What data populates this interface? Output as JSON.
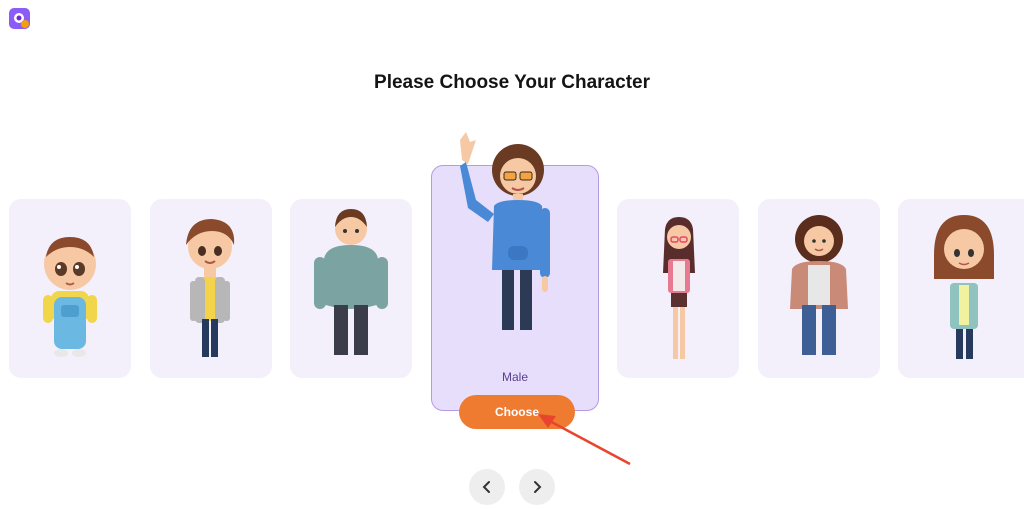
{
  "page": {
    "title": "Please Choose Your Character"
  },
  "characters": [
    {
      "id": "baby"
    },
    {
      "id": "boy"
    },
    {
      "id": "chubby-man"
    },
    {
      "id": "male",
      "label": "Male",
      "selected": true
    },
    {
      "id": "girl"
    },
    {
      "id": "curly-woman"
    },
    {
      "id": "woman"
    }
  ],
  "actions": {
    "choose_label": "Choose"
  },
  "icons": {
    "logo": "app-logo-icon",
    "prev": "chevron-left-icon",
    "next": "chevron-right-icon"
  },
  "colors": {
    "accent": "#ef7b30",
    "card_bg": "#f3f0fc",
    "selected_bg": "#e7defb",
    "selected_border": "#b59ae6",
    "annotation": "#e8452c"
  }
}
